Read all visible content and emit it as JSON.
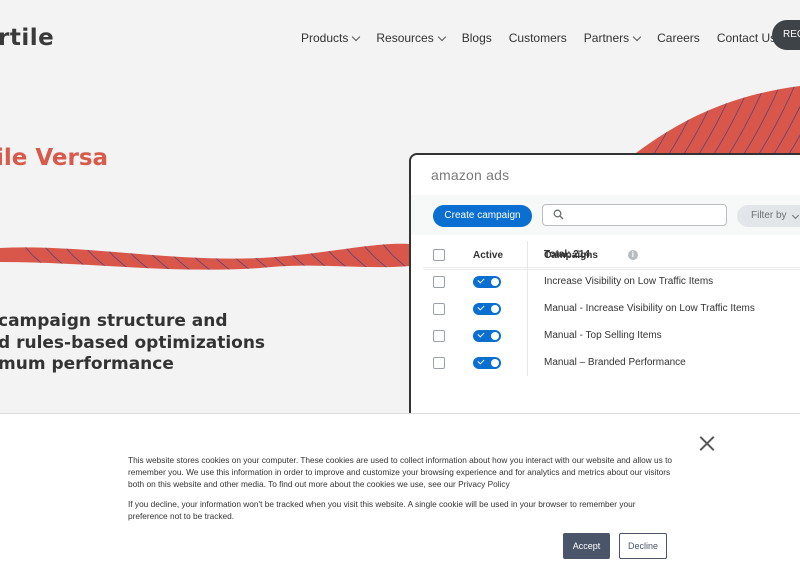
{
  "header": {
    "logo_text": "rtile",
    "nav": [
      {
        "label": "Products",
        "has_dropdown": true
      },
      {
        "label": "Resources",
        "has_dropdown": true
      },
      {
        "label": "Blogs",
        "has_dropdown": false
      },
      {
        "label": "Customers",
        "has_dropdown": false
      },
      {
        "label": "Partners",
        "has_dropdown": true
      },
      {
        "label": "Careers",
        "has_dropdown": false
      },
      {
        "label": "Contact Us",
        "has_dropdown": false
      }
    ],
    "cta_label": "REC"
  },
  "hero": {
    "title": "ile Versa",
    "lines": [
      "campaign structure and",
      "d rules-based optimizations",
      "mum performance"
    ]
  },
  "mock": {
    "brand": "amazon ads",
    "create_button": "Create campaign",
    "search_placeholder": "",
    "filter_label": "Filter by",
    "columns": {
      "active": "Active",
      "campaigns": "Campaigns"
    },
    "total": "Total: 214",
    "rows": [
      {
        "name": "Increase Visibility on Low Traffic Items",
        "active": true
      },
      {
        "name": "Manual - Increase Visibility on Low Traffic Items",
        "active": true
      },
      {
        "name": "Manual -  Top Selling Items",
        "active": true
      },
      {
        "name": "Manual – Branded Performance",
        "active": true
      }
    ]
  },
  "cookie": {
    "text1": "This website stores cookies on your computer. These cookies are used to collect information about how you interact with our website and allow us to remember you. We use this information in order to improve and customize your browsing experience and for analytics and metrics about our visitors both on this website and other media. To find out more about the cookies we use, see our Privacy Policy",
    "text2": "If you decline, your information won't be tracked when you visit this website. A single cookie will be used in your browser to remember your preference not to be tracked.",
    "accept_label": "Accept",
    "decline_label": "Decline"
  },
  "colors": {
    "brand_red": "#d85a4a",
    "primary_blue": "#0a6fd0",
    "dark": "#3d4347",
    "accept_bg": "#4a5569"
  }
}
